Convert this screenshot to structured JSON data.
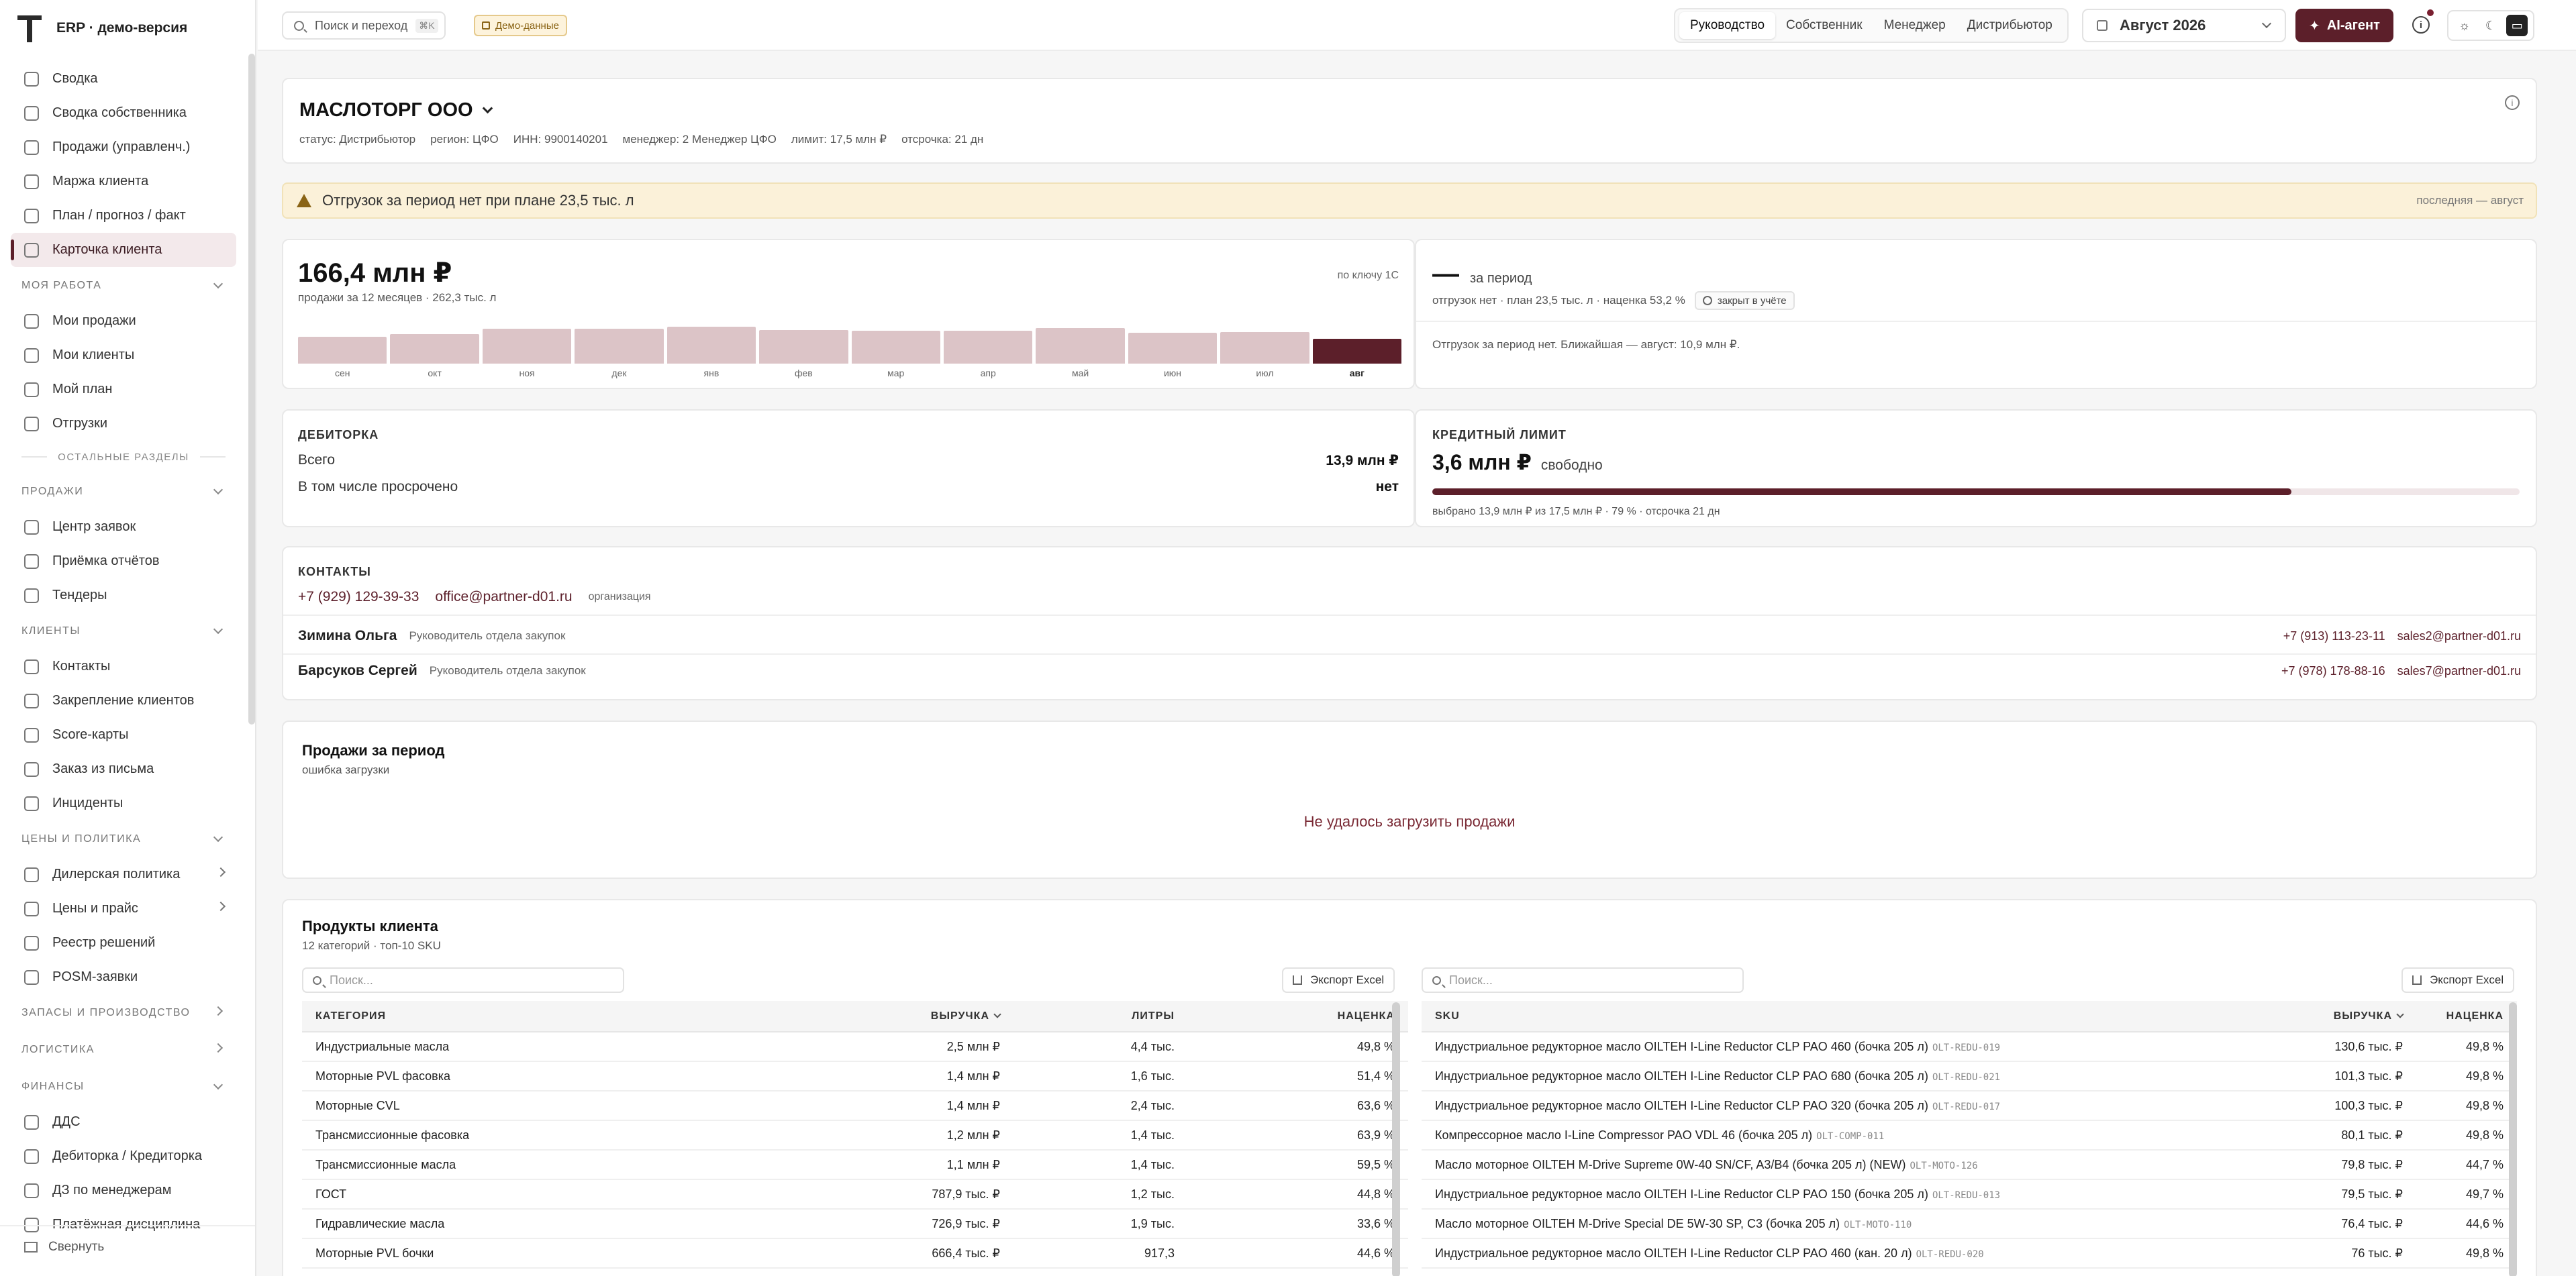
{
  "app": {
    "title": "ERP · демо-версия"
  },
  "sidebar": {
    "top_items": [
      {
        "label": "Сводка",
        "icon": "grid-icon"
      },
      {
        "label": "Сводка собственника",
        "icon": "briefcase-icon"
      },
      {
        "label": "Продажи (управленч.)",
        "icon": "bar-chart-icon"
      },
      {
        "label": "Маржа клиента",
        "icon": "scale-icon"
      },
      {
        "label": "План / прогноз / факт",
        "icon": "target-icon"
      },
      {
        "label": "Карточка клиента",
        "icon": "id-card-icon",
        "active": true
      }
    ],
    "sections": [
      {
        "title": "МОЯ РАБОТА",
        "expanded": true,
        "items": [
          "Мои продажи",
          "Мои клиенты",
          "Мой план",
          "Отгрузки"
        ]
      },
      {
        "divider": "ОСТАЛЬНЫЕ РАЗДЕЛЫ"
      },
      {
        "title": "ПРОДАЖИ",
        "expanded": true,
        "items": [
          "Центр заявок",
          "Приёмка отчётов",
          "Тендеры"
        ]
      },
      {
        "title": "КЛИЕНТЫ",
        "expanded": true,
        "items": [
          "Контакты",
          "Закрепление клиентов",
          "Score-карты",
          "Заказ из письма",
          "Инциденты"
        ]
      },
      {
        "title": "ЦЕНЫ И ПОЛИТИКА",
        "expanded": true,
        "items": [
          "Дилерская политика",
          "Цены и прайс",
          "Реестр решений",
          "POSM-заявки"
        ]
      },
      {
        "title": "ЗАПАСЫ И ПРОИЗВОДСТВО",
        "expanded": false,
        "items": []
      },
      {
        "title": "ЛОГИСТИКА",
        "expanded": false,
        "items": []
      },
      {
        "title": "ФИНАНСЫ",
        "expanded": true,
        "items": [
          "ДДС",
          "Дебиторка / Кредиторка",
          "ДЗ по менеджерам",
          "Платёжная дисциплина"
        ]
      }
    ],
    "collapse_label": "Свернуть"
  },
  "topbar": {
    "search_placeholder": "Поиск и переход",
    "search_shortcut": "⌘K",
    "demo_badge": "Демо-данные",
    "roles": [
      "Руководство",
      "Собственник",
      "Менеджер",
      "Дистрибьютор"
    ],
    "active_role": "Руководство",
    "period": "Август 2026",
    "ai_button": "AI-агент"
  },
  "client": {
    "name": "МАСЛОТОРГ ООО",
    "meta": [
      "статус: Дистрибьютор",
      "регион: ЦФО",
      "ИНН: 9900140201",
      "менеджер: 2 Менеджер ЦФО",
      "лимит: 17,5 млн ₽",
      "отсрочка: 21 дн"
    ]
  },
  "alert": {
    "text": "Отгрузок за период нет при плане 23,5 тыс. л",
    "right": "последняя — август"
  },
  "revenue": {
    "value": "166,4 млн ₽",
    "subtitle": "продажи за 12 месяцев · 262,3 тыс. л",
    "badge": "по ключу 1С",
    "months": [
      "сен",
      "окт",
      "ноя",
      "дек",
      "янв",
      "фев",
      "мар",
      "апр",
      "май",
      "июн",
      "июл",
      "авг"
    ],
    "levels": [
      0.72,
      0.78,
      0.92,
      0.92,
      0.98,
      0.9,
      0.88,
      0.88,
      0.94,
      0.82,
      0.84,
      0.66
    ],
    "current_index": 11
  },
  "period_card": {
    "value": "—",
    "suffix": "за период",
    "line": "отгрузок нет · план 23,5 тыс. л · наценка 53,2 %",
    "chip": "закрыт в учёте",
    "note": "Отгрузок за период нет. Ближайшая — август: 10,9 млн ₽."
  },
  "receivables": {
    "title": "ДЕБИТОРКА",
    "total_label": "Всего",
    "total_value": "13,9 млн ₽",
    "overdue_label": "В том числе просрочено",
    "overdue_value": "нет"
  },
  "credit": {
    "title": "КРЕДИТНЫЙ ЛИМИТ",
    "value": "3,6 млн ₽",
    "suffix": "свободно",
    "used_fraction": 0.79,
    "note": "выбрано 13,9 млн ₽ из 17,5 млн ₽ · 79 % · отсрочка 21 дн"
  },
  "contacts": {
    "title": "КОНТАКТЫ",
    "org_phone": "+7 (929) 129-39-33",
    "org_email": "office@partner-d01.ru",
    "org_label": "организация",
    "people": [
      {
        "name": "Зимина Ольга",
        "role": "Руководитель отдела закупок",
        "phone": "+7 (913) 113-23-11",
        "email": "sales2@partner-d01.ru"
      },
      {
        "name": "Барсуков Сергей",
        "role": "Руководитель отдела закупок",
        "phone": "+7 (978) 178-88-16",
        "email": "sales7@partner-d01.ru"
      }
    ]
  },
  "sales_period": {
    "title": "Продажи за период",
    "subtitle": "ошибка загрузки",
    "error": "Не удалось загрузить продажи"
  },
  "products": {
    "title": "Продукты клиента",
    "subtitle": "12 категорий · топ-10 SKU",
    "search_placeholder": "Поиск...",
    "export_label": "Экспорт Excel",
    "categories_columns": [
      "КАТЕГОРИЯ",
      "ВЫРУЧКА",
      "ЛИТРЫ",
      "НАЦЕНКА"
    ],
    "categories": [
      [
        "Индустриальные масла",
        "2,5 млн ₽",
        "4,4 тыс.",
        "49,8 %"
      ],
      [
        "Моторные PVL фасовка",
        "1,4 млн ₽",
        "1,6 тыс.",
        "51,4 %"
      ],
      [
        "Моторные CVL",
        "1,4 млн ₽",
        "2,4 тыс.",
        "63,6 %"
      ],
      [
        "Трансмиссионные фасовка",
        "1,2 млн ₽",
        "1,4 тыс.",
        "63,9 %"
      ],
      [
        "Трансмиссионные масла",
        "1,1 млн ₽",
        "1,4 тыс.",
        "59,5 %"
      ],
      [
        "ГОСТ",
        "787,9 тыс. ₽",
        "1,2 тыс.",
        "44,8 %"
      ],
      [
        "Гидравлические масла",
        "726,9 тыс. ₽",
        "1,9 тыс.",
        "33,6 %"
      ],
      [
        "Моторные PVL бочки",
        "666,4 тыс. ₽",
        "917,3",
        "44,6 %"
      ]
    ],
    "sku_columns": [
      "SKU",
      "ВЫРУЧКА",
      "НАЦЕНКА"
    ],
    "skus": [
      [
        "Индустриальное редукторное масло OILTEH I-Line Reductor CLP PAO 460 (бочка 205 л)",
        "OLT-REDU-019",
        "130,6 тыс. ₽",
        "49,8 %"
      ],
      [
        "Индустриальное редукторное масло OILTEH I-Line Reductor CLP PAO 680 (бочка 205 л)",
        "OLT-REDU-021",
        "101,3 тыс. ₽",
        "49,8 %"
      ],
      [
        "Индустриальное редукторное масло OILTEH I-Line Reductor CLP PAO 320 (бочка 205 л)",
        "OLT-REDU-017",
        "100,3 тыс. ₽",
        "49,8 %"
      ],
      [
        "Компрессорное масло I-Line Compressor PAO VDL 46 (бочка 205 л)",
        "OLT-COMP-011",
        "80,1 тыс. ₽",
        "49,8 %"
      ],
      [
        "Масло моторное OILTEH M-Drive Supreme 0W-40 SN/CF, A3/B4 (бочка 205 л) (NEW)",
        "OLT-MOTO-126",
        "79,8 тыс. ₽",
        "44,7 %"
      ],
      [
        "Индустриальное редукторное масло OILTEH I-Line Reductor CLP PAO 150 (бочка 205 л)",
        "OLT-REDU-013",
        "79,5 тыс. ₽",
        "49,7 %"
      ],
      [
        "Масло моторное OILTEH M-Drive Special DE 5W-30 SP, C3 (бочка 205 л)",
        "OLT-MOTO-110",
        "76,4 тыс. ₽",
        "44,6 %"
      ],
      [
        "Индустриальное редукторное масло OILTEH I-Line Reductor CLP PAO 460 (кан. 20 л)",
        "OLT-REDU-020",
        "76 тыс. ₽",
        "49,8 %"
      ]
    ]
  }
}
